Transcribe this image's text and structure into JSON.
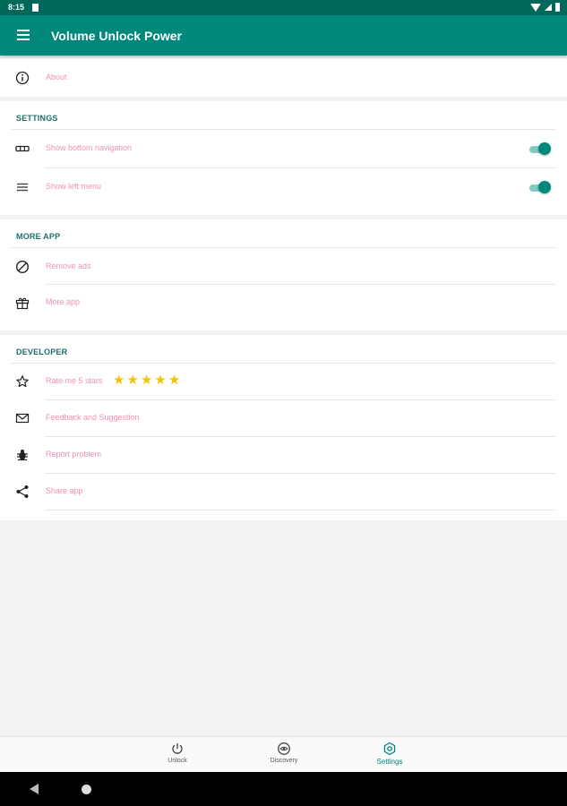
{
  "status_bar": {
    "time": "8:15"
  },
  "app_bar": {
    "title": "Volume Unlock Power"
  },
  "about": {
    "label": "About"
  },
  "settings": {
    "section_title": "SETTINGS",
    "items": [
      {
        "label": "Show bottom navigation",
        "icon": "bottom-navigation-icon",
        "toggle_on": true
      },
      {
        "label": "Show left menu",
        "icon": "left-menu-icon",
        "toggle_on": true
      }
    ]
  },
  "more_app": {
    "section_title": "MORE APP",
    "items": [
      {
        "label": "Remove ads",
        "icon": "block-icon"
      },
      {
        "label": "More app",
        "icon": "gift-icon"
      }
    ]
  },
  "developer": {
    "section_title": "DEVELOPER",
    "rate": {
      "label": "Rate me 5 stars",
      "stars": 5,
      "star_glyph": "★"
    },
    "items": [
      {
        "label": "Feedback and Suggestion",
        "icon": "mail-icon"
      },
      {
        "label": "Report problem",
        "icon": "bug-icon"
      },
      {
        "label": "Share app",
        "icon": "share-icon"
      }
    ]
  },
  "bottom_nav": {
    "items": [
      {
        "label": "Unlock",
        "icon": "power-icon",
        "active": false
      },
      {
        "label": "Discovery",
        "icon": "discovery-icon",
        "active": false
      },
      {
        "label": "Settings",
        "icon": "settings-icon",
        "active": true
      }
    ]
  },
  "colors": {
    "primary": "#00897b",
    "primary_dark": "#00675b",
    "item_text": "#f48fb1",
    "section_title": "#1f6f6a",
    "star": "#f5c400"
  }
}
